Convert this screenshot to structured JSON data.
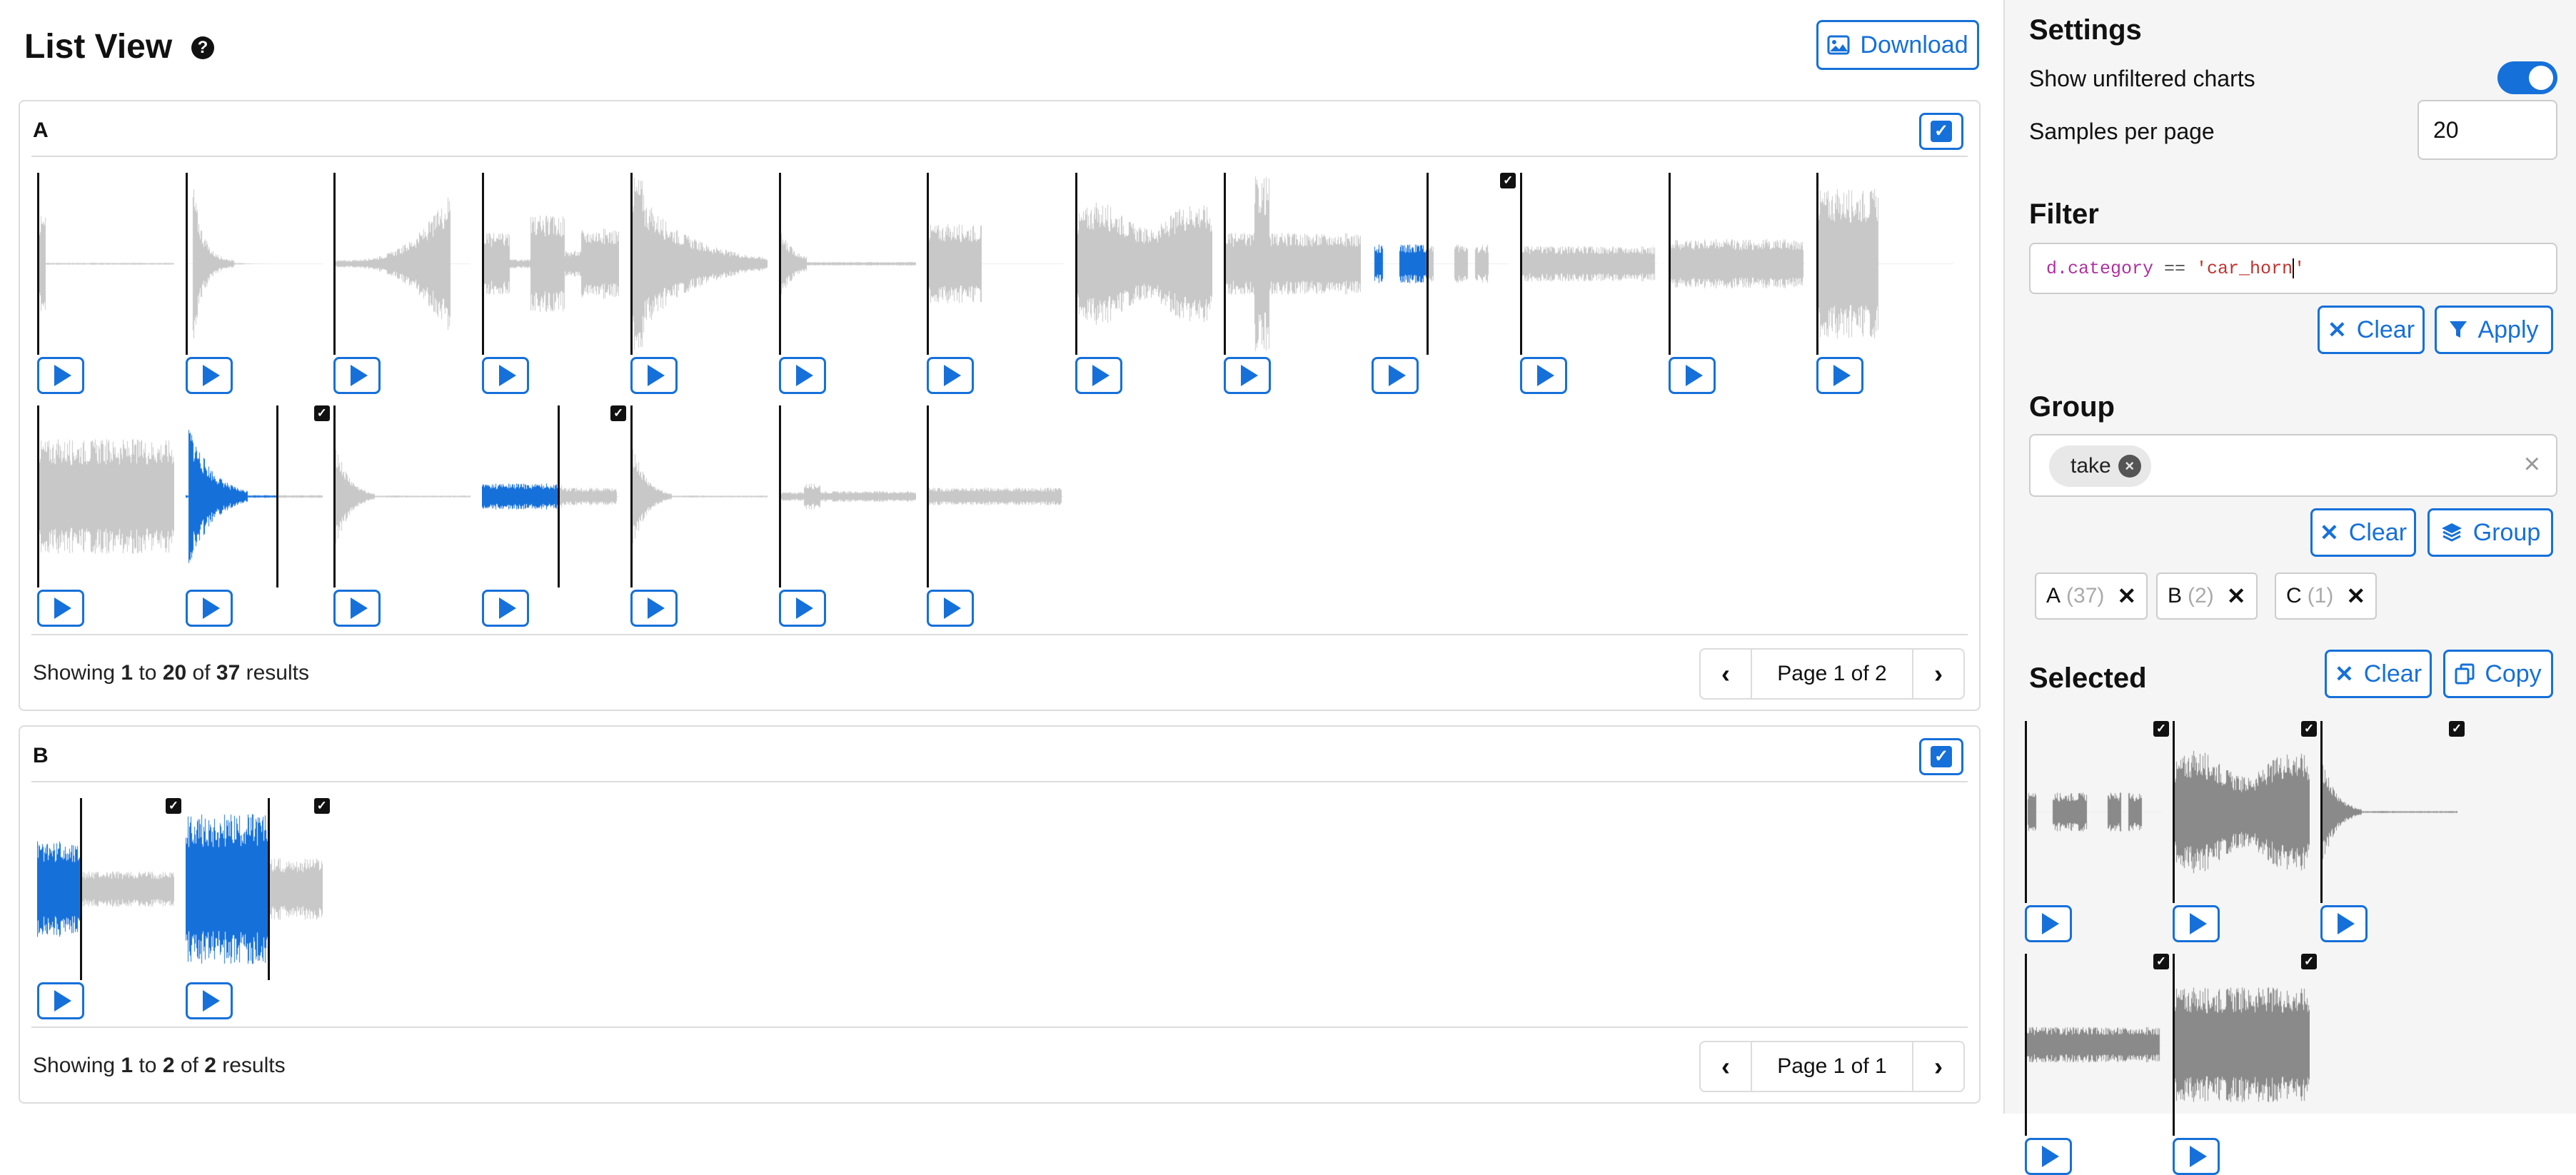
{
  "header": {
    "title": "List View",
    "help_icon": "help-circle-icon",
    "download_label": "Download",
    "download_icon": "image-icon"
  },
  "groups": [
    {
      "name": "A",
      "checked": true,
      "results": {
        "prefix": "Showing ",
        "start": "1",
        "mid1": " to ",
        "end": "20",
        "mid2": " of ",
        "total": "37",
        "suffix": " results"
      },
      "pagination": {
        "label": "Page 1 of 2"
      },
      "samples": [
        {
          "id": "a1",
          "shape": "click",
          "cursor": 0.0,
          "selected": false,
          "highlight": false
        },
        {
          "id": "a2",
          "shape": "spike",
          "cursor": 0.0,
          "selected": false,
          "highlight": false
        },
        {
          "id": "a3",
          "shape": "swell",
          "cursor": 0.0,
          "selected": false,
          "highlight": false
        },
        {
          "id": "a4",
          "shape": "bursts",
          "cursor": 0.0,
          "selected": false,
          "highlight": false
        },
        {
          "id": "a5",
          "shape": "decay",
          "cursor": 0.0,
          "selected": false,
          "highlight": false
        },
        {
          "id": "a6",
          "shape": "blip",
          "cursor": 0.0,
          "selected": false,
          "highlight": false
        },
        {
          "id": "a7",
          "shape": "block",
          "cursor": 0.0,
          "selected": false,
          "highlight": false
        },
        {
          "id": "a8",
          "shape": "dense",
          "cursor": 0.0,
          "selected": false,
          "highlight": false
        },
        {
          "id": "a9",
          "shape": "impact",
          "cursor": 0.0,
          "selected": false,
          "highlight": false
        },
        {
          "id": "a10",
          "shape": "beeps",
          "cursor": 0.4,
          "selected": true,
          "highlight": true
        },
        {
          "id": "a11",
          "shape": "steady",
          "cursor": 0.0,
          "selected": false,
          "highlight": false
        },
        {
          "id": "a12",
          "shape": "steady2",
          "cursor": 0.0,
          "selected": false,
          "highlight": false
        },
        {
          "id": "a13",
          "shape": "short",
          "cursor": 0.0,
          "selected": false,
          "highlight": false
        },
        {
          "id": "a14",
          "shape": "noise",
          "cursor": 0.0,
          "selected": false,
          "highlight": false
        },
        {
          "id": "a15",
          "shape": "burst",
          "cursor": 0.66,
          "selected": true,
          "highlight": true
        },
        {
          "id": "a16",
          "shape": "fadespike",
          "cursor": 0.0,
          "selected": false,
          "highlight": false
        },
        {
          "id": "a17",
          "shape": "front",
          "cursor": 0.55,
          "selected": true,
          "highlight": true
        },
        {
          "id": "a18",
          "shape": "fadespike",
          "cursor": 0.0,
          "selected": false,
          "highlight": false
        },
        {
          "id": "a19",
          "shape": "small",
          "cursor": 0.0,
          "selected": false,
          "highlight": false
        },
        {
          "id": "a20",
          "shape": "flat",
          "cursor": 0.0,
          "selected": false,
          "highlight": false
        }
      ]
    },
    {
      "name": "B",
      "checked": true,
      "results": {
        "prefix": "Showing ",
        "start": "1",
        "mid1": " to ",
        "end": "2",
        "mid2": " of ",
        "total": "2",
        "suffix": " results"
      },
      "pagination": {
        "label": "Page 1 of 1"
      },
      "samples": [
        {
          "id": "b1",
          "shape": "siren",
          "cursor": 0.31,
          "selected": true,
          "highlight": true
        },
        {
          "id": "b2",
          "shape": "wide",
          "cursor": 0.6,
          "selected": true,
          "highlight": true
        }
      ]
    }
  ],
  "sidebar": {
    "settings": {
      "title": "Settings",
      "show_unfiltered_label": "Show unfiltered charts",
      "show_unfiltered_on": true,
      "samples_per_page_label": "Samples per page",
      "samples_per_page_value": "20"
    },
    "filter": {
      "title": "Filter",
      "expr_var": "d.category",
      "expr_op": " == ",
      "expr_str_a": "'car_horn",
      "expr_str_b": "'",
      "clear_label": "Clear",
      "apply_label": "Apply",
      "clear_icon": "x-icon",
      "apply_icon": "funnel-icon"
    },
    "group": {
      "title": "Group",
      "chip_label": "take",
      "clear_label": "Clear",
      "group_label": "Group",
      "group_icon": "layers-icon",
      "tags": [
        {
          "name": "A",
          "count": "(37)"
        },
        {
          "name": "B",
          "count": "(2)"
        },
        {
          "name": "C",
          "count": "(1)"
        }
      ]
    },
    "selected": {
      "title": "Selected",
      "clear_label": "Clear",
      "copy_label": "Copy",
      "copy_icon": "copy-icon",
      "samples": [
        {
          "id": "s1",
          "shape": "beeps",
          "cursor": 0.0
        },
        {
          "id": "s2",
          "shape": "dense",
          "cursor": 0.0
        },
        {
          "id": "s3",
          "shape": "fadespike",
          "cursor": 0.0
        },
        {
          "id": "s4",
          "shape": "steady",
          "cursor": 0.0
        },
        {
          "id": "s5",
          "shape": "noise",
          "cursor": 0.0
        }
      ]
    }
  },
  "colors": {
    "accent": "#1670d9",
    "wave_grey": "#c8c8c8",
    "wave_blue": "#1670d9",
    "wave_selected": "#8a8a8a"
  }
}
